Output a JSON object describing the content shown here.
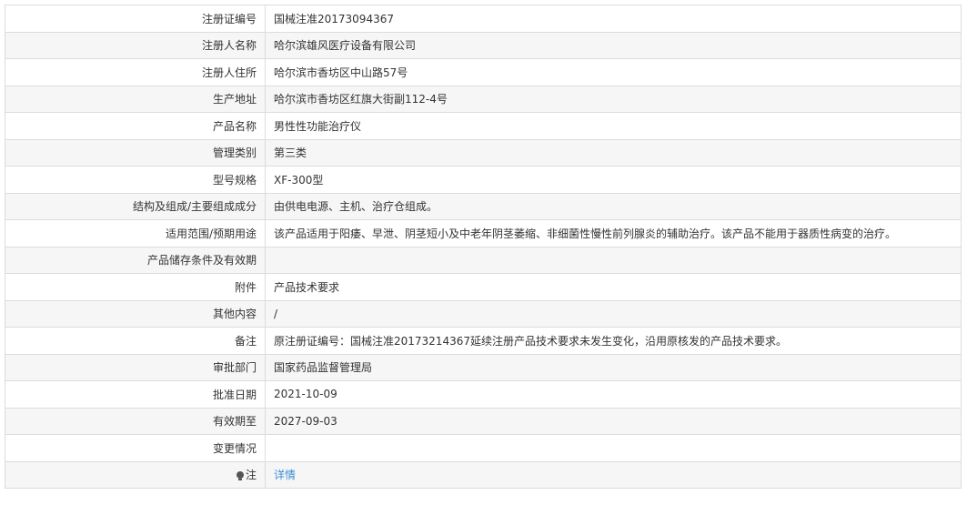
{
  "rows": [
    {
      "label": "注册证编号",
      "value": "国械注准20173094367"
    },
    {
      "label": "注册人名称",
      "value": "哈尔滨雄风医疗设备有限公司"
    },
    {
      "label": "注册人住所",
      "value": "哈尔滨市香坊区中山路57号"
    },
    {
      "label": "生产地址",
      "value": "哈尔滨市香坊区红旗大街副112-4号"
    },
    {
      "label": "产品名称",
      "value": "男性性功能治疗仪"
    },
    {
      "label": "管理类别",
      "value": "第三类"
    },
    {
      "label": "型号规格",
      "value": "XF-300型"
    },
    {
      "label": "结构及组成/主要组成成分",
      "value": "由供电电源、主机、治疗仓组成。"
    },
    {
      "label": "适用范围/预期用途",
      "value": "该产品适用于阳痿、早泄、阴茎短小及中老年阴茎萎缩、非细菌性慢性前列腺炎的辅助治疗。该产品不能用于器质性病变的治疗。"
    },
    {
      "label": "产品储存条件及有效期",
      "value": ""
    },
    {
      "label": "附件",
      "value": "产品技术要求"
    },
    {
      "label": "其他内容",
      "value": "/"
    },
    {
      "label": "备注",
      "value": "原注册证编号：国械注准20173214367延续注册产品技术要求未发生变化，沿用原核发的产品技术要求。"
    },
    {
      "label": "审批部门",
      "value": "国家药品监督管理局"
    },
    {
      "label": "批准日期",
      "value": "2021-10-09"
    },
    {
      "label": "有效期至",
      "value": "2027-09-03"
    },
    {
      "label": "变更情况",
      "value": ""
    }
  ],
  "note": {
    "label": "注",
    "icon": "lightbulb-icon",
    "link_text": "详情",
    "link_color": "#3b8fd6"
  }
}
